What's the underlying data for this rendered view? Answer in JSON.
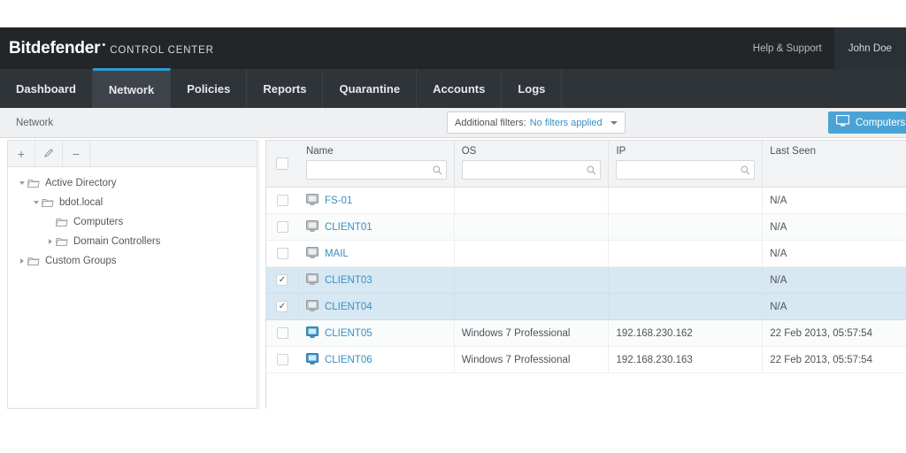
{
  "header": {
    "brand_name": "Bitdefender",
    "brand_tm": "•",
    "brand_sub": "CONTROL CENTER",
    "help_label": "Help & Support",
    "user_label": "John Doe",
    "bg_color": "#222629"
  },
  "nav": {
    "items": [
      {
        "label": "Dashboard",
        "active": false
      },
      {
        "label": "Network",
        "active": true
      },
      {
        "label": "Policies",
        "active": false
      },
      {
        "label": "Reports",
        "active": false
      },
      {
        "label": "Quarantine",
        "active": false
      },
      {
        "label": "Accounts",
        "active": false
      },
      {
        "label": "Logs",
        "active": false
      }
    ],
    "active_accent": "#2c9ad6"
  },
  "subbar": {
    "breadcrumb": "Network",
    "filters_label": "Additional filters:",
    "filters_value": "No filters applied",
    "view_button": "Computers",
    "view_button_color": "#4aa3d4"
  },
  "sidebar": {
    "toolbar": [
      {
        "name": "add",
        "glyph": "+"
      },
      {
        "name": "edit",
        "glyph": "✎"
      },
      {
        "name": "remove",
        "glyph": "−"
      }
    ],
    "tree": [
      {
        "label": "Active Directory",
        "depth": 0,
        "state": "expanded"
      },
      {
        "label": "bdot.local",
        "depth": 1,
        "state": "expanded"
      },
      {
        "label": "Computers",
        "depth": 2,
        "state": "leaf"
      },
      {
        "label": "Domain Controllers",
        "depth": 2,
        "state": "collapsed"
      },
      {
        "label": "Custom Groups",
        "depth": 0,
        "state": "collapsed"
      }
    ]
  },
  "table": {
    "columns": [
      {
        "key": "name",
        "label": "Name",
        "has_search": true
      },
      {
        "key": "os",
        "label": "OS",
        "has_search": true
      },
      {
        "key": "ip",
        "label": "IP",
        "has_search": true
      },
      {
        "key": "last_seen",
        "label": "Last Seen",
        "has_search": false
      }
    ],
    "search": {
      "name": "",
      "os": "",
      "ip": "",
      "placeholder": ""
    },
    "rows": [
      {
        "checked": false,
        "icon": "monitor-gray",
        "name": "FS-01",
        "os": "",
        "ip": "",
        "last_seen": "N/A"
      },
      {
        "checked": false,
        "icon": "monitor-gray",
        "name": "CLIENT01",
        "os": "",
        "ip": "",
        "last_seen": "N/A"
      },
      {
        "checked": false,
        "icon": "monitor-gray",
        "name": "MAIL",
        "os": "",
        "ip": "",
        "last_seen": "N/A"
      },
      {
        "checked": true,
        "icon": "monitor-gray",
        "name": "CLIENT03",
        "os": "",
        "ip": "",
        "last_seen": "N/A"
      },
      {
        "checked": true,
        "icon": "monitor-gray",
        "name": "CLIENT04",
        "os": "",
        "ip": "",
        "last_seen": "N/A"
      },
      {
        "checked": false,
        "icon": "monitor-blue",
        "name": "CLIENT05",
        "os": "Windows 7 Professional",
        "ip": "192.168.230.162",
        "last_seen": "22 Feb 2013, 05:57:54"
      },
      {
        "checked": false,
        "icon": "monitor-blue",
        "name": "CLIENT06",
        "os": "Windows 7 Professional",
        "ip": "192.168.230.163",
        "last_seen": "22 Feb 2013, 05:57:54"
      }
    ],
    "header_checkbox_checked": false,
    "selected_row_color": "#d7e8f3",
    "link_color": "#3a8fc4"
  }
}
